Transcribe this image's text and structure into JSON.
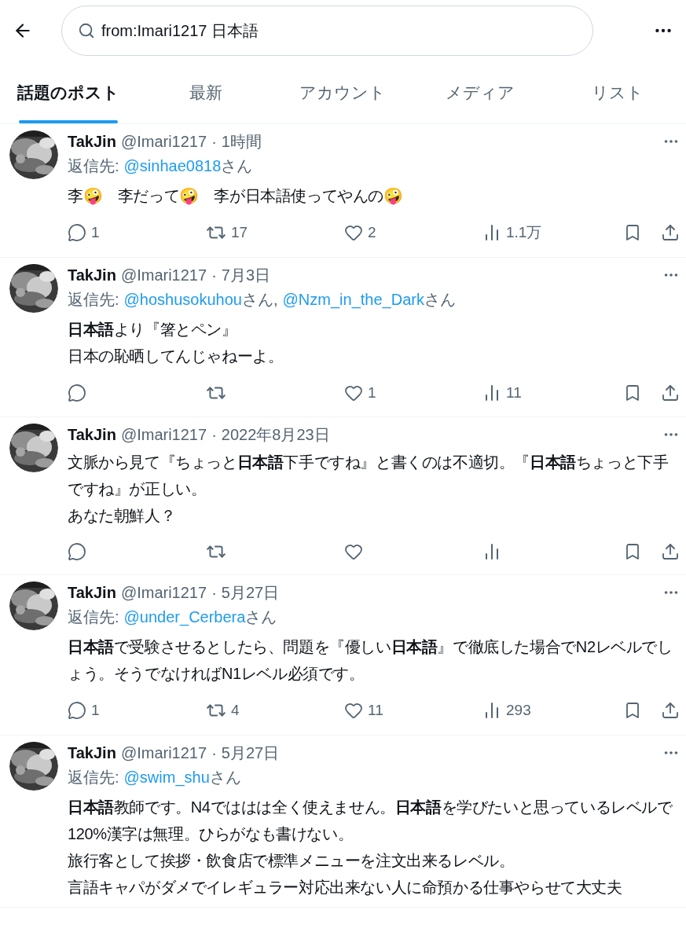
{
  "search": {
    "value": "from:Imari1217 日本語"
  },
  "tabs": [
    {
      "label": "話題のポスト",
      "selected": true
    },
    {
      "label": "最新",
      "selected": false
    },
    {
      "label": "アカウント",
      "selected": false
    },
    {
      "label": "メディア",
      "selected": false
    },
    {
      "label": "リスト",
      "selected": false
    }
  ],
  "posts": [
    {
      "name": "TakJin",
      "handle": "@Imari1217",
      "separator": "·",
      "time": "1時間",
      "reply_label": "返信先:",
      "mentions": [
        {
          "handle": "@sinhae0818",
          "suffix": "さん"
        }
      ],
      "body": [
        "李🤪　李だって🤪　李が日本語使ってやんの🤪"
      ],
      "stats": {
        "replies": "1",
        "reposts": "17",
        "likes": "2",
        "views": "1.1万"
      }
    },
    {
      "name": "TakJin",
      "handle": "@Imari1217",
      "separator": "·",
      "time": "7月3日",
      "reply_label": "返信先:",
      "mentions": [
        {
          "handle": "@hoshusokuhou",
          "suffix": "さん,"
        },
        {
          "handle": "@Nzm_in_the_Dark",
          "suffix": "さん"
        }
      ],
      "body": [
        "**日本語**より『箸とペン』",
        "日本の恥晒してんじゃねーよ。"
      ],
      "stats": {
        "likes": "1",
        "views": "11"
      }
    },
    {
      "name": "TakJin",
      "handle": "@Imari1217",
      "separator": "·",
      "time": "2022年8月23日",
      "body": [
        "文脈から見て『ちょっと**日本語**下手ですね』と書くのは不適切。『**日本語**ちょっと下手ですね』が正しい。",
        "あなた朝鮮人？"
      ],
      "actions_shown": true
    },
    {
      "name": "TakJin",
      "handle": "@Imari1217",
      "separator": "·",
      "time": "5月27日",
      "reply_label": "返信先:",
      "mentions": [
        {
          "handle": "@under_Cerbera",
          "suffix": "さん"
        }
      ],
      "body": [
        "**日本語**で受験させるとしたら、問題を『優しい**日本語**』で徹底した場合でN2レベルでしょう。そうでなければN1レベル必須です。"
      ],
      "stats": {
        "replies": "1",
        "reposts": "4",
        "likes": "11",
        "views": "293"
      }
    },
    {
      "name": "TakJin",
      "handle": "@Imari1217",
      "separator": "·",
      "time": "5月27日",
      "reply_label": "返信先:",
      "mentions": [
        {
          "handle": "@swim_shu",
          "suffix": "さん"
        }
      ],
      "body": [
        "**日本語**教師です。N4でははは全く使えません。**日本語**を学びたいと思っているレベルで120%漢字は無理。ひらがなも書けない。",
        "旅行客として挨拶・飲食店で標準メニューを注文出来るレベル。",
        "言語キャパがダメでイレギュラー対応出来ない人に命預かる仕事やらせて大丈夫"
      ],
      "actions_shown": false
    }
  ]
}
